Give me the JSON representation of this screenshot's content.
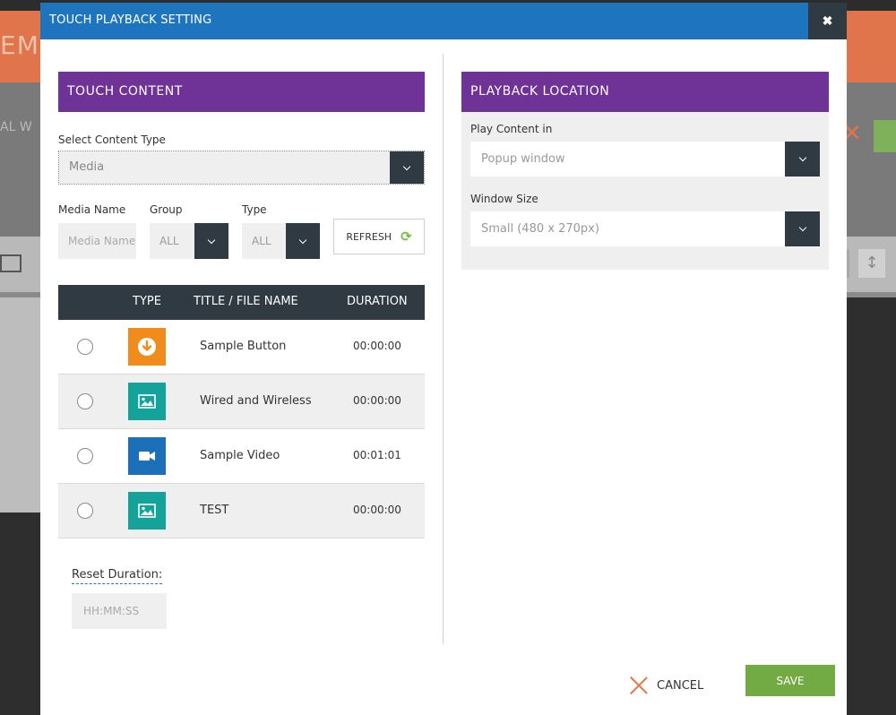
{
  "background": {
    "header_fragment": "EMP",
    "toolbar_fragment": "AL  W"
  },
  "modal": {
    "title": "TOUCH PLAYBACK SETTING",
    "close_glyph": "✖"
  },
  "touch_content": {
    "heading": "TOUCH  CONTENT",
    "content_type_label": "Select Content Type",
    "content_type_value": "Media",
    "media_name_label": "Media Name",
    "media_name_placeholder": "Media Name",
    "group_label": "Group",
    "group_value": "ALL",
    "type_label": "Type",
    "type_value": "ALL",
    "refresh_label": "REFRESH",
    "table": {
      "headers": {
        "type": "TYPE",
        "title": "TITLE / FILE NAME",
        "duration": "DURATION"
      },
      "rows": [
        {
          "icon": "download-button-icon",
          "color": "#f08c1c",
          "title": "Sample Button",
          "duration": "00:00:00"
        },
        {
          "icon": "image-icon",
          "color": "#14a39a",
          "title": "Wired and Wireless",
          "duration": "00:00:00"
        },
        {
          "icon": "video-camera-icon",
          "color": "#1b70b9",
          "title": "Sample Video",
          "duration": "00:01:01"
        },
        {
          "icon": "image-icon",
          "color": "#14a39a",
          "title": "TEST",
          "duration": "00:00:00"
        }
      ]
    },
    "reset_duration_label": "Reset Duration:",
    "reset_duration_placeholder": "HH:MM:SS"
  },
  "playback_location": {
    "heading": "PLAYBACK  LOCATION",
    "play_content_label": "Play Content in",
    "play_content_value": "Popup window",
    "window_size_label": "Window Size",
    "window_size_value": "Small (480 x 270px)"
  },
  "footer": {
    "cancel_label": "CANCEL",
    "save_label": "SAVE"
  },
  "colors": {
    "header_blue": "#1f75bd",
    "section_purple": "#6f3296",
    "dark_slate": "#2f3a43",
    "save_green": "#72aa44",
    "cancel_orange": "#e8764a"
  }
}
